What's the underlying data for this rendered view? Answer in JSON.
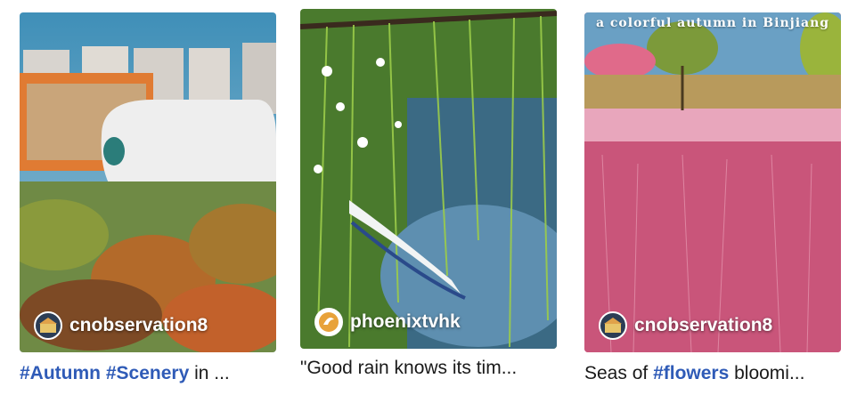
{
  "cards": [
    {
      "author": "cnobservation8",
      "caption_parts": [
        {
          "text": "#Autumn",
          "tag": true
        },
        {
          "text": " ",
          "tag": false
        },
        {
          "text": "#Scenery",
          "tag": true
        },
        {
          "text": " in ...",
          "tag": false
        }
      ]
    },
    {
      "author": "phoenixtvhk",
      "caption_parts": [
        {
          "text": "\"Good rain knows its tim...",
          "tag": false
        }
      ]
    },
    {
      "author": "cnobservation8",
      "overlay_text": "a colorful autumn in Binjiang",
      "caption_parts": [
        {
          "text": "Seas of ",
          "tag": false
        },
        {
          "text": "#flowers",
          "tag": true
        },
        {
          "text": " bloomi...",
          "tag": false
        }
      ]
    }
  ],
  "colors": {
    "hashtag": "#2f5bb7",
    "caption": "#1a1a1a"
  }
}
